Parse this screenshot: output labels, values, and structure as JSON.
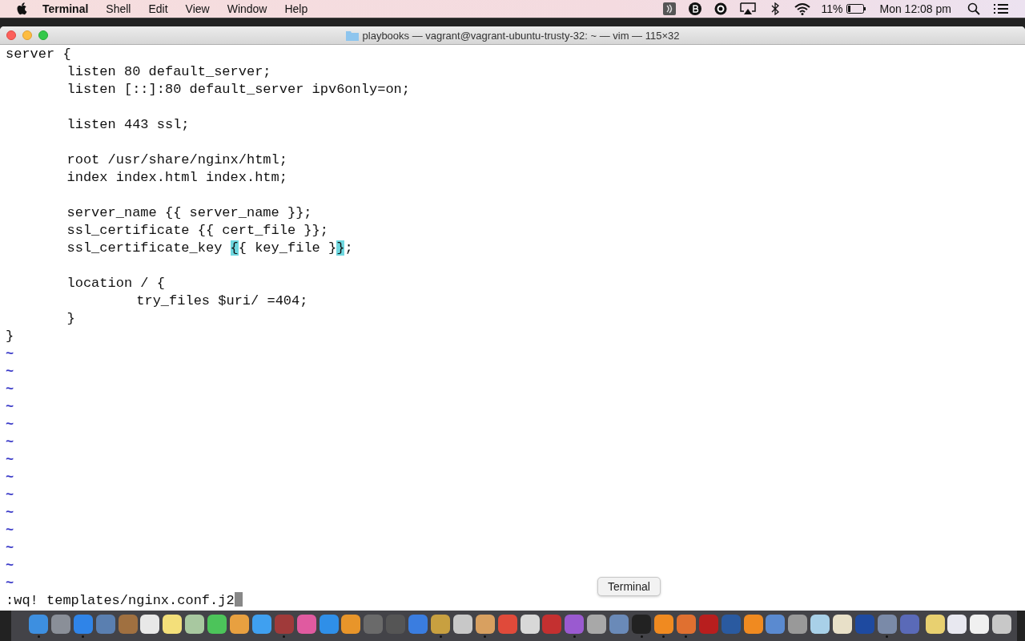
{
  "menu_bar": {
    "app": "Terminal",
    "items": [
      "Shell",
      "Edit",
      "View",
      "Window",
      "Help"
    ],
    "battery": "11%",
    "clock": "Mon 12:08 pm"
  },
  "window": {
    "title": "playbooks — vagrant@vagrant-ubuntu-trusty-32: ~ — vim — 115×32"
  },
  "editor": {
    "lines": [
      {
        "gap_before": false,
        "segments": [
          {
            "text": "server {",
            "highlight": false
          }
        ]
      },
      {
        "gap_before": false,
        "segments": [
          {
            "text": "\tlisten 80 default_server;",
            "highlight": false
          }
        ]
      },
      {
        "gap_before": false,
        "segments": [
          {
            "text": "\tlisten [::]:80 default_server ipv6only=on;",
            "highlight": false
          }
        ]
      },
      {
        "gap_before": true,
        "segments": [
          {
            "text": "\tlisten 443 ssl;",
            "highlight": false
          }
        ]
      },
      {
        "gap_before": true,
        "segments": [
          {
            "text": "\troot /usr/share/nginx/html;",
            "highlight": false
          }
        ]
      },
      {
        "gap_before": false,
        "segments": [
          {
            "text": "\tindex index.html index.htm;",
            "highlight": false
          }
        ]
      },
      {
        "gap_before": true,
        "segments": [
          {
            "text": "\tserver_name {{ server_name }};",
            "highlight": false
          }
        ]
      },
      {
        "gap_before": false,
        "segments": [
          {
            "text": "\tssl_certificate {{ cert_file }};",
            "highlight": false
          }
        ]
      },
      {
        "gap_before": false,
        "segments": [
          {
            "text": "\tssl_certificate_key ",
            "highlight": false
          },
          {
            "text": "{",
            "highlight": true
          },
          {
            "text": "{ key_file }",
            "highlight": false
          },
          {
            "text": "}",
            "highlight": true
          },
          {
            "text": ";",
            "highlight": false
          }
        ]
      },
      {
        "gap_before": true,
        "segments": [
          {
            "text": "\tlocation / {",
            "highlight": false
          }
        ]
      },
      {
        "gap_before": false,
        "segments": [
          {
            "text": "\t\t try_files $uri/ =404;",
            "highlight": false
          }
        ]
      },
      {
        "gap_before": false,
        "segments": [
          {
            "text": "\t}",
            "highlight": false
          }
        ]
      },
      {
        "gap_before": false,
        "segments": [
          {
            "text": "}",
            "highlight": false
          }
        ]
      }
    ],
    "tildes": [
      "~",
      "~",
      "~",
      "~",
      "~",
      "~",
      "~",
      "~",
      "~",
      "~",
      "~",
      "~",
      "~",
      "~"
    ],
    "command_line": ":wq! templates/nginx.conf.j2"
  },
  "dock": {
    "tooltip": "Terminal",
    "items": [
      {
        "running": true
      },
      {
        "running": false
      },
      {
        "running": true
      },
      {
        "running": false
      },
      {
        "running": false
      },
      {
        "running": false
      },
      {
        "running": false
      },
      {
        "running": false
      },
      {
        "running": false
      },
      {
        "running": false
      },
      {
        "running": false
      },
      {
        "running": true
      },
      {
        "running": false
      },
      {
        "running": false
      },
      {
        "running": false
      },
      {
        "running": false
      },
      {
        "running": false
      },
      {
        "running": false
      },
      {
        "running": true
      },
      {
        "running": false
      },
      {
        "running": true
      },
      {
        "running": false
      },
      {
        "running": false
      },
      {
        "running": false
      },
      {
        "running": true
      },
      {
        "running": false
      },
      {
        "running": false
      },
      {
        "running": true
      },
      {
        "running": true
      },
      {
        "running": true
      },
      {
        "running": false
      },
      {
        "running": false
      },
      {
        "running": false
      },
      {
        "running": false
      },
      {
        "running": false
      },
      {
        "running": false
      },
      {
        "running": false
      },
      {
        "running": false
      },
      {
        "running": true
      },
      {
        "running": false
      },
      {
        "running": false
      },
      {
        "running": false
      },
      {
        "running": false
      },
      {
        "running": false
      }
    ]
  }
}
